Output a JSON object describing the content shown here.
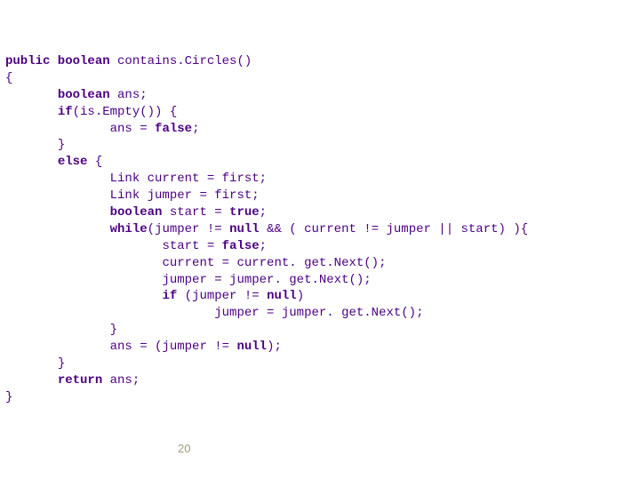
{
  "code": {
    "sig_pre": "public boolean",
    "sig_name": " contains.Circles()",
    "brace_open": "{",
    "decl_kw": "boolean",
    "decl_rest": " ans;",
    "if_kw": "if",
    "if_cond": "(is.Empty()) {",
    "ans_false_pre": "ans = ",
    "false_kw": "false",
    "semi": ";",
    "brace_close": "}",
    "else_kw": "else",
    "else_open": " {",
    "link_cur": "Link current = first;",
    "link_jmp": "Link jumper = first;",
    "bool_kw": "boolean",
    "start_true_pre": " start = ",
    "true_kw": "true",
    "while_kw": "while",
    "while_cond_pre": "(jumper != ",
    "null_kw": "null",
    "while_cond_mid": " && ( current != jumper || start) ){",
    "start_false_pre": "start = ",
    "cur_next": "current = current. get.Next();",
    "jmp_next": "jumper = jumper. get.Next();",
    "if2_kw": "if",
    "if2_pre": " (jumper != ",
    "if2_post": ")",
    "jmp_next2": "jumper = jumper. get.Next();",
    "ans_pre": "ans = (jumper != ",
    "ans_post": ");",
    "return_kw": "return",
    "return_rest": " ans;"
  },
  "pagenum": "20"
}
